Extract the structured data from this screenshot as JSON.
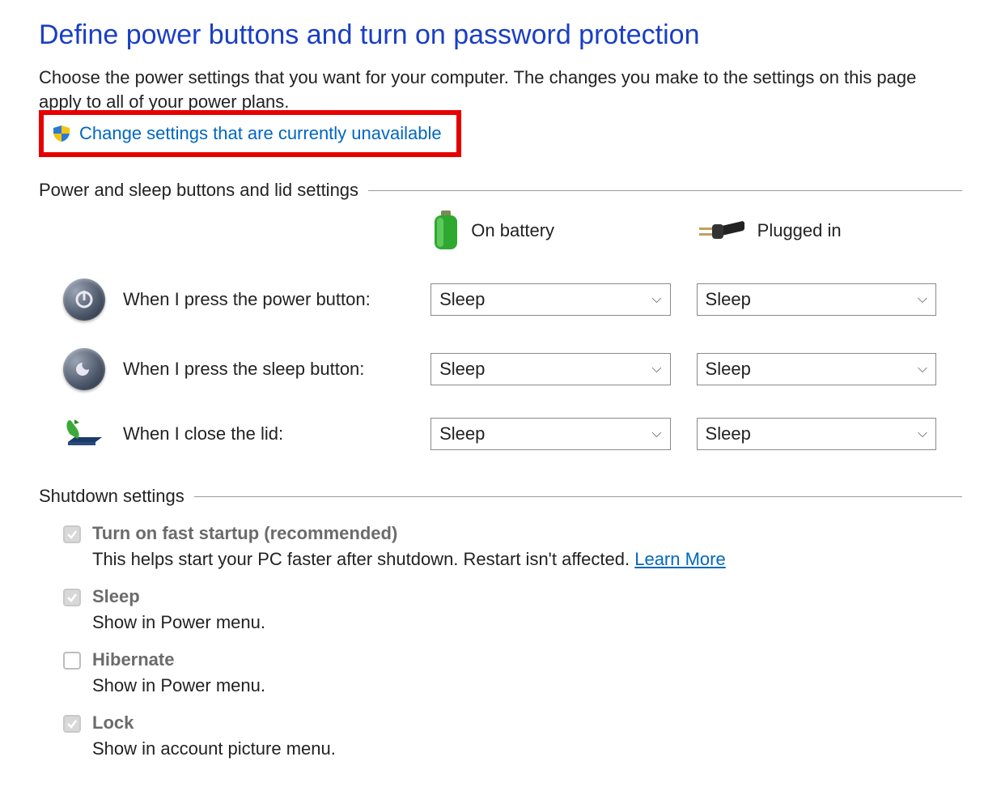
{
  "heading": "Define power buttons and turn on password protection",
  "description": "Choose the power settings that you want for your computer. The changes you make to the settings on this page apply to all of your power plans.",
  "change_link": "Change settings that are currently unavailable",
  "section1": "Power and sleep buttons and lid settings",
  "col_battery": "On battery",
  "col_plugged": "Plugged in",
  "rows": {
    "power": {
      "label": "When I press the power button:",
      "battery": "Sleep",
      "plugged": "Sleep"
    },
    "sleep": {
      "label": "When I press the sleep button:",
      "battery": "Sleep",
      "plugged": "Sleep"
    },
    "lid": {
      "label": "When I close the lid:",
      "battery": "Sleep",
      "plugged": "Sleep"
    }
  },
  "section2": "Shutdown settings",
  "shutdown": {
    "fast": {
      "checked": true,
      "title": "Turn on fast startup (recommended)",
      "sub": "This helps start your PC faster after shutdown. Restart isn't affected. ",
      "learn": "Learn More"
    },
    "sleep": {
      "checked": true,
      "title": "Sleep",
      "sub": "Show in Power menu."
    },
    "hibernate": {
      "checked": false,
      "title": "Hibernate",
      "sub": "Show in Power menu."
    },
    "lock": {
      "checked": true,
      "title": "Lock",
      "sub": "Show in account picture menu."
    }
  }
}
